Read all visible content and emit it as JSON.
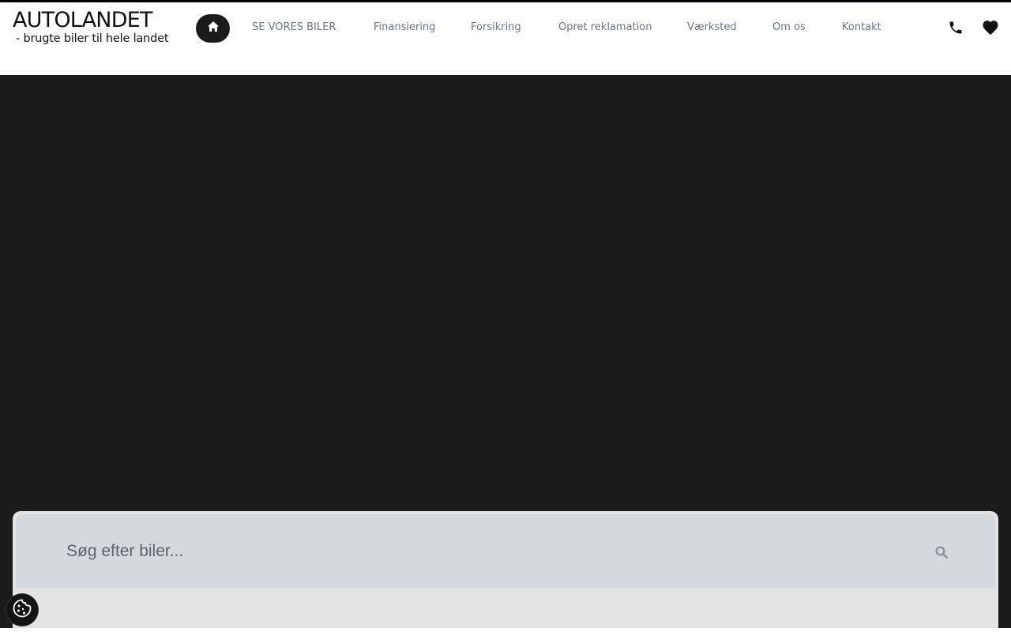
{
  "header": {
    "logo": {
      "title": "AUTOLANDET",
      "subtitle": "- brugte biler til hele landet"
    },
    "nav": [
      {
        "label": "SE VORES BILER"
      },
      {
        "label": "Finansiering"
      },
      {
        "label": "Forsikring"
      },
      {
        "label": "Opret reklamation"
      },
      {
        "label": "Værksted"
      },
      {
        "label": "Om os"
      },
      {
        "label": "Kontakt"
      }
    ],
    "icons": {
      "home": "home-icon",
      "phone": "phone-icon",
      "favorites": "heart-icon"
    }
  },
  "search": {
    "placeholder": "Søg efter biler...",
    "value": "",
    "icon": "search-icon"
  },
  "cookie": {
    "icon": "cookie-icon"
  },
  "colors": {
    "hero_background": "#1b1b1b",
    "nav_text": "#6b7485",
    "search_bar": "#d5d8dc",
    "search_panel": "#e3e3e3"
  }
}
